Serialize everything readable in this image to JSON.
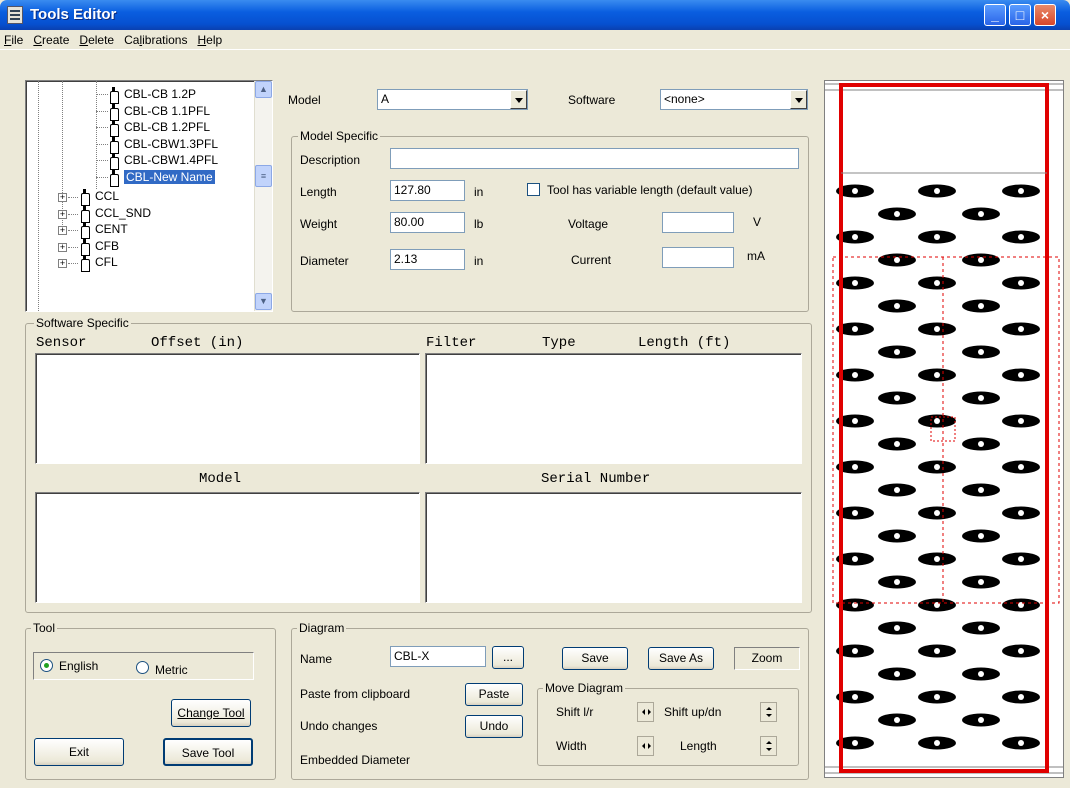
{
  "window": {
    "title": "Tools Editor",
    "min": "_",
    "max": "□",
    "close": "×"
  },
  "menu": [
    {
      "label": "File",
      "key": "F",
      "rest": "ile"
    },
    {
      "label": "Create",
      "key": "C",
      "rest": "reate"
    },
    {
      "label": "Delete",
      "key": "D",
      "rest": "elete"
    },
    {
      "label": "Calibrations",
      "pre": "Ca",
      "key": "l",
      "rest": "ibrations"
    },
    {
      "label": "Help",
      "key": "H",
      "rest": "elp"
    }
  ],
  "tree": {
    "children": [
      "CBL-CB 1.2P",
      "CBL-CB 1.1PFL",
      "CBL-CB 1.2PFL",
      "CBL-CBW1.3PFL",
      "CBL-CBW1.4PFL",
      "CBL-New Name"
    ],
    "selected": "CBL-New Name",
    "roots": [
      "CCL",
      "CCL_SND",
      "CENT",
      "CFB",
      "CFL"
    ]
  },
  "model": {
    "label": "Model",
    "value": "A",
    "software_label": "Software",
    "software_value": "<none>",
    "group_label": "Model Specific",
    "description_label": "Description",
    "description_value": "",
    "length_label": "Length",
    "length_value": "127.80",
    "length_unit": "in",
    "variable_length_label": "Tool has variable length (default value)",
    "weight_label": "Weight",
    "weight_value": "80.00",
    "weight_unit": "lb",
    "diameter_label": "Diameter",
    "diameter_value": "2.13",
    "diameter_unit": "in",
    "voltage_label": "Voltage",
    "voltage_value": "",
    "voltage_unit": "V",
    "current_label": "Current",
    "current_value": "",
    "current_unit": "mA"
  },
  "software_specific": {
    "group_label": "Software Specific",
    "col_sensor": "Sensor",
    "col_offset": "Offset (in)",
    "col_filter": "Filter",
    "col_type": "Type",
    "col_length": "Length (ft)",
    "col_model": "Model",
    "col_serial": "Serial Number"
  },
  "tool": {
    "group_label": "Tool",
    "english": "English",
    "metric": "Metric",
    "units_selected": "English",
    "change_tool": "Change Tool",
    "exit": "Exit",
    "save_tool": "Save Tool"
  },
  "diagram": {
    "group_label": "Diagram",
    "name_label": "Name",
    "name_value": "CBL-X",
    "browse": "...",
    "save": "Save",
    "save_as": "Save As",
    "zoom": "Zoom",
    "paste_label": "Paste from clipboard",
    "paste": "Paste",
    "undo_label": "Undo changes",
    "undo": "Undo",
    "embedded_label": "Embedded Diameter",
    "move_group": "Move Diagram",
    "shift_lr": "Shift l/r",
    "shift_ud": "Shift up/dn",
    "width": "Width",
    "length": "Length"
  },
  "colors": {
    "tool_outline": "#e00000",
    "selection": "#316ac5",
    "titlebar": "#0a5ee0"
  }
}
